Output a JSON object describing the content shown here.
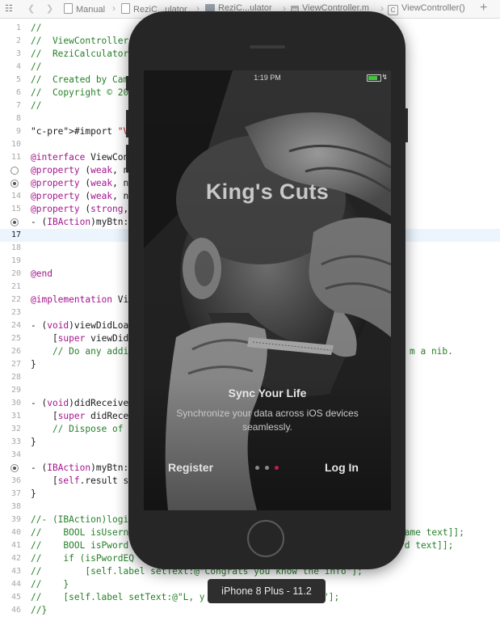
{
  "jumpbar": {
    "items": [
      "Manual",
      "ReziC...ulator",
      "ReziC...ulator",
      "ViewController.m",
      "ViewController()"
    ],
    "add_label": "+"
  },
  "editor": {
    "current_line": 17,
    "lines": [
      {
        "n": "1",
        "t": "//"
      },
      {
        "n": "2",
        "t": "//  ViewController"
      },
      {
        "n": "3",
        "t": "//  ReziCalculator"
      },
      {
        "n": "4",
        "t": "//"
      },
      {
        "n": "5",
        "t": "//  Created by Cam"
      },
      {
        "n": "6",
        "t": "//  Copyright © 20"
      },
      {
        "n": "7",
        "t": "//"
      },
      {
        "n": "8",
        "t": ""
      },
      {
        "n": "9",
        "t": "#import \"ViewContr"
      },
      {
        "n": "10",
        "t": ""
      },
      {
        "n": "11",
        "t": "@interface ViewCon"
      },
      {
        "n": "12",
        "t": "@property (weak, n"
      },
      {
        "n": "13",
        "t": "@property (weak, n"
      },
      {
        "n": "14",
        "t": "@property (weak, n"
      },
      {
        "n": "15",
        "t": "@property (strong,"
      },
      {
        "n": "16",
        "t": "- (IBAction)myBtn:"
      },
      {
        "n": "17",
        "t": ""
      },
      {
        "n": "18",
        "t": ""
      },
      {
        "n": "19",
        "t": ""
      },
      {
        "n": "20",
        "t": "@end"
      },
      {
        "n": "21",
        "t": ""
      },
      {
        "n": "22",
        "t": "@implementation Vi"
      },
      {
        "n": "23",
        "t": ""
      },
      {
        "n": "24",
        "t": "- (void)viewDidLoa"
      },
      {
        "n": "25",
        "t": "    [super viewDid"
      },
      {
        "n": "26",
        "t": "    // Do any addi",
        "r": "m a nib."
      },
      {
        "n": "27",
        "t": "}"
      },
      {
        "n": "28",
        "t": ""
      },
      {
        "n": "29",
        "t": ""
      },
      {
        "n": "30",
        "t": "- (void)didReceive"
      },
      {
        "n": "31",
        "t": "    [super didRece"
      },
      {
        "n": "32",
        "t": "    // Dispose of"
      },
      {
        "n": "33",
        "t": "}"
      },
      {
        "n": "34",
        "t": ""
      },
      {
        "n": "35",
        "t": "- (IBAction)myBtn:"
      },
      {
        "n": "36",
        "t": "    [self.result s"
      },
      {
        "n": "37",
        "t": "}"
      },
      {
        "n": "38",
        "t": ""
      },
      {
        "n": "39",
        "t": "//- (IBAction)logi"
      },
      {
        "n": "40",
        "t": "//    BOOL isUsern",
        "r": "name text]];"
      },
      {
        "n": "41",
        "t": "//    BOOL isPword",
        "r": "rd text]];"
      },
      {
        "n": "42",
        "t": "//    if (isPwordEQ"
      },
      {
        "n": "43",
        "t": "//        [self.label setText:@\"Congrats you know the info\"];"
      },
      {
        "n": "44",
        "t": "//    }"
      },
      {
        "n": "45",
        "t": "//    [self.label setText:@\"L, y",
        "r": "\"];"
      },
      {
        "n": "46",
        "t": "//}"
      }
    ]
  },
  "simulator": {
    "status_time": "1:19 PM",
    "app_title": "King's Cuts",
    "heading": "Sync Your Life",
    "description": "Synchronize your data across iOS devices seamlessly.",
    "register_label": "Register",
    "login_label": "Log In",
    "page_count": 3,
    "active_page": 3,
    "device_label": "iPhone 8 Plus - 11.2"
  },
  "colors": {
    "accent_dot": "#c6175a",
    "comment": "#26802a",
    "keyword": "#a3148d",
    "string": "#c41a16"
  }
}
